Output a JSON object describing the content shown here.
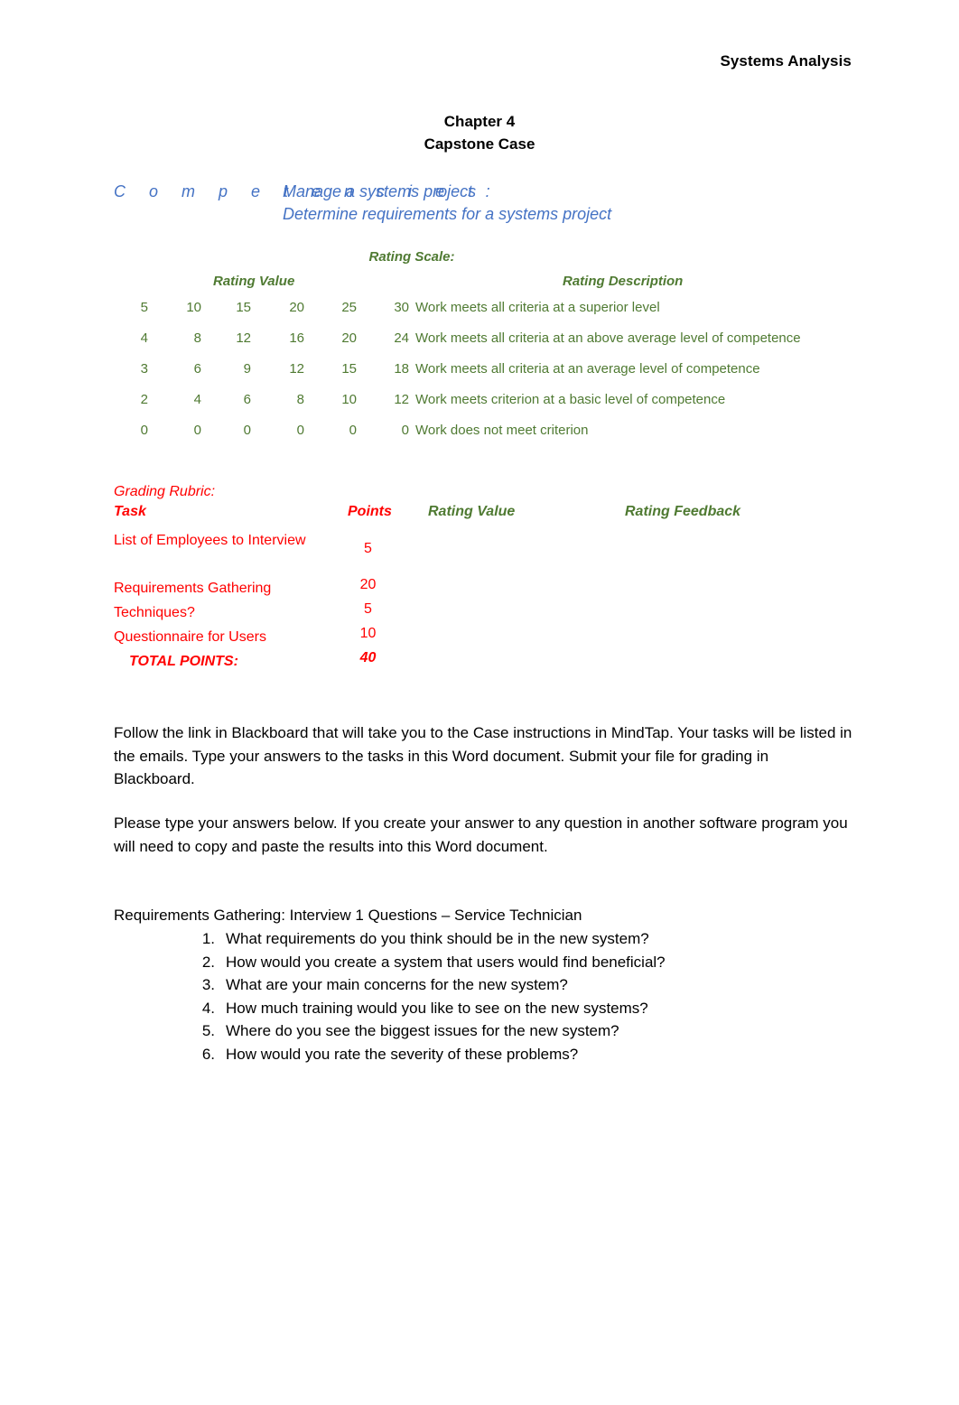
{
  "document": {
    "running_header": "Systems Analysis",
    "title_lines": [
      "Chapter 4",
      "Capstone Case"
    ]
  },
  "competencies": {
    "label": "C o m p e t e n c i e s:",
    "items": [
      "Manage a systems project",
      "Determine requirements for a systems project"
    ],
    "color": "#4472C4"
  },
  "rating_scale": {
    "title": "Rating Scale:",
    "column_headers": {
      "rating_value": "Rating Value",
      "rating_description": "Rating Description"
    },
    "color": "#4F7A32",
    "rows": [
      {
        "values": [
          "5",
          "10",
          "15",
          "20",
          "25",
          "30"
        ],
        "description": "Work meets all criteria at a superior level"
      },
      {
        "values": [
          "4",
          "8",
          "12",
          "16",
          "20",
          "24"
        ],
        "description": "Work meets all criteria at an above average level of competence"
      },
      {
        "values": [
          "3",
          "6",
          "9",
          "12",
          "15",
          "18"
        ],
        "description": "Work meets all criteria at an average level of competence"
      },
      {
        "values": [
          "2",
          "4",
          "6",
          "8",
          "10",
          "12"
        ],
        "description": "Work meets criterion at a basic level of competence"
      },
      {
        "values": [
          "0",
          "0",
          "0",
          "0",
          "0",
          "0"
        ],
        "description": "Work does not meet criterion"
      }
    ]
  },
  "grading_rubric": {
    "title": "Grading Rubric:",
    "color_task": "#FF0000",
    "color_rating": "#4F7A32",
    "headers": {
      "task": "Task",
      "points": "Points",
      "rating_value": "Rating Value",
      "rating_feedback": "Rating Feedback"
    },
    "rows": [
      {
        "task": "List of Employees to Interview",
        "points": "5",
        "rating_value": "",
        "rating_feedback": ""
      },
      {
        "task": "Requirements Gathering",
        "points": "20",
        "rating_value": "",
        "rating_feedback": ""
      },
      {
        "task": "Techniques?",
        "points": "5",
        "rating_value": "",
        "rating_feedback": ""
      },
      {
        "task": "Questionnaire for Users",
        "points": "10",
        "rating_value": "",
        "rating_feedback": ""
      }
    ],
    "total": {
      "label": "TOTAL POINTS:",
      "points": "40"
    }
  },
  "body": {
    "paragraph_1": "Follow the link in Blackboard that will take you to the Case instructions in MindTap.  Your tasks will be listed in the emails.  Type your answers to the tasks in this Word document. Submit your file for grading in Blackboard.",
    "paragraph_2": "Please type your answers below.  If you create your answer to any question in another software program you will need to copy and paste the results into this Word document."
  },
  "interview_section": {
    "heading": "Requirements Gathering: Interview 1 Questions – Service Technician",
    "questions": [
      {
        "number": "1.",
        "text": "What requirements do you think should be in the new system?"
      },
      {
        "number": "2.",
        "text": "How would you create a system that users would find beneficial?"
      },
      {
        "number": "3.",
        "text": "What are your main concerns for the new system?"
      },
      {
        "number": "4.",
        "text": "How much training would you like to see on the new systems?"
      },
      {
        "number": "5.",
        "text": "Where do you see the biggest issues for the new system?"
      },
      {
        "number": "6.",
        "text": "How would you rate the severity of these problems?"
      }
    ]
  }
}
